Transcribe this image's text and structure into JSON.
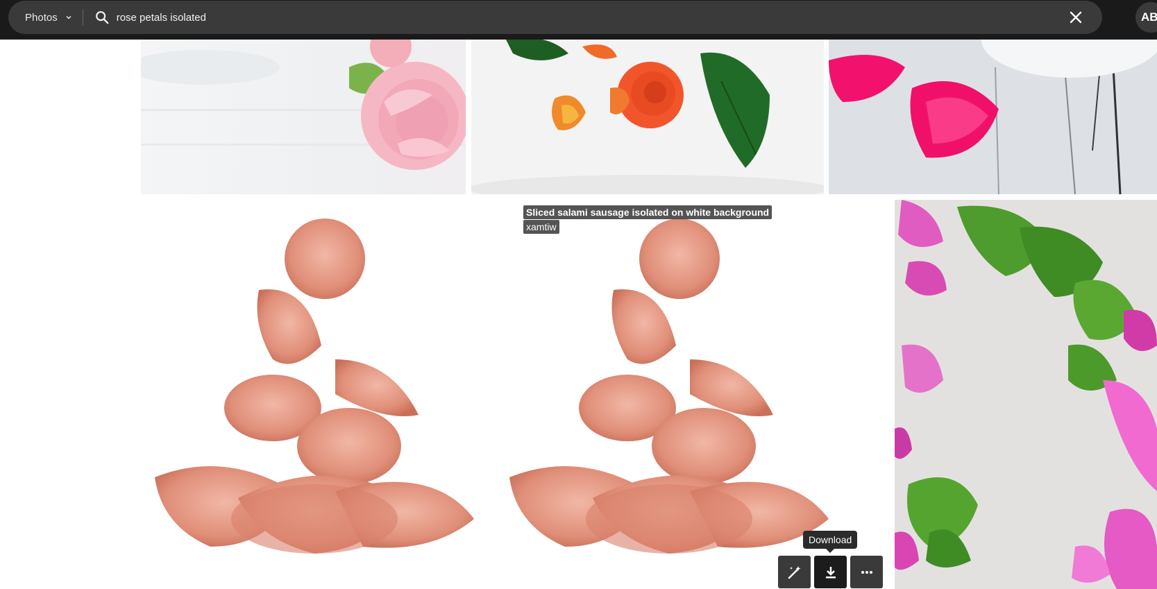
{
  "search": {
    "type_label": "Photos",
    "query": "rose petals isolated"
  },
  "user": {
    "initials": "AB"
  },
  "hover_item": {
    "title": "Sliced salami sausage isolated on white background",
    "author": "xamtiw"
  },
  "actions": {
    "download_tooltip": "Download"
  },
  "icons": {
    "type_chevron": "chevron-down-icon",
    "search": "search-icon",
    "clear": "close-icon",
    "ai_edit": "magic-wand-icon",
    "download": "download-icon",
    "more": "more-horizontal-icon"
  },
  "colors": {
    "topbar_bg": "#1a1a1a",
    "searchbar_bg": "#3a3a3a",
    "action_bg": "#3a3a3a",
    "tooltip_bg": "#2b2b2b"
  }
}
